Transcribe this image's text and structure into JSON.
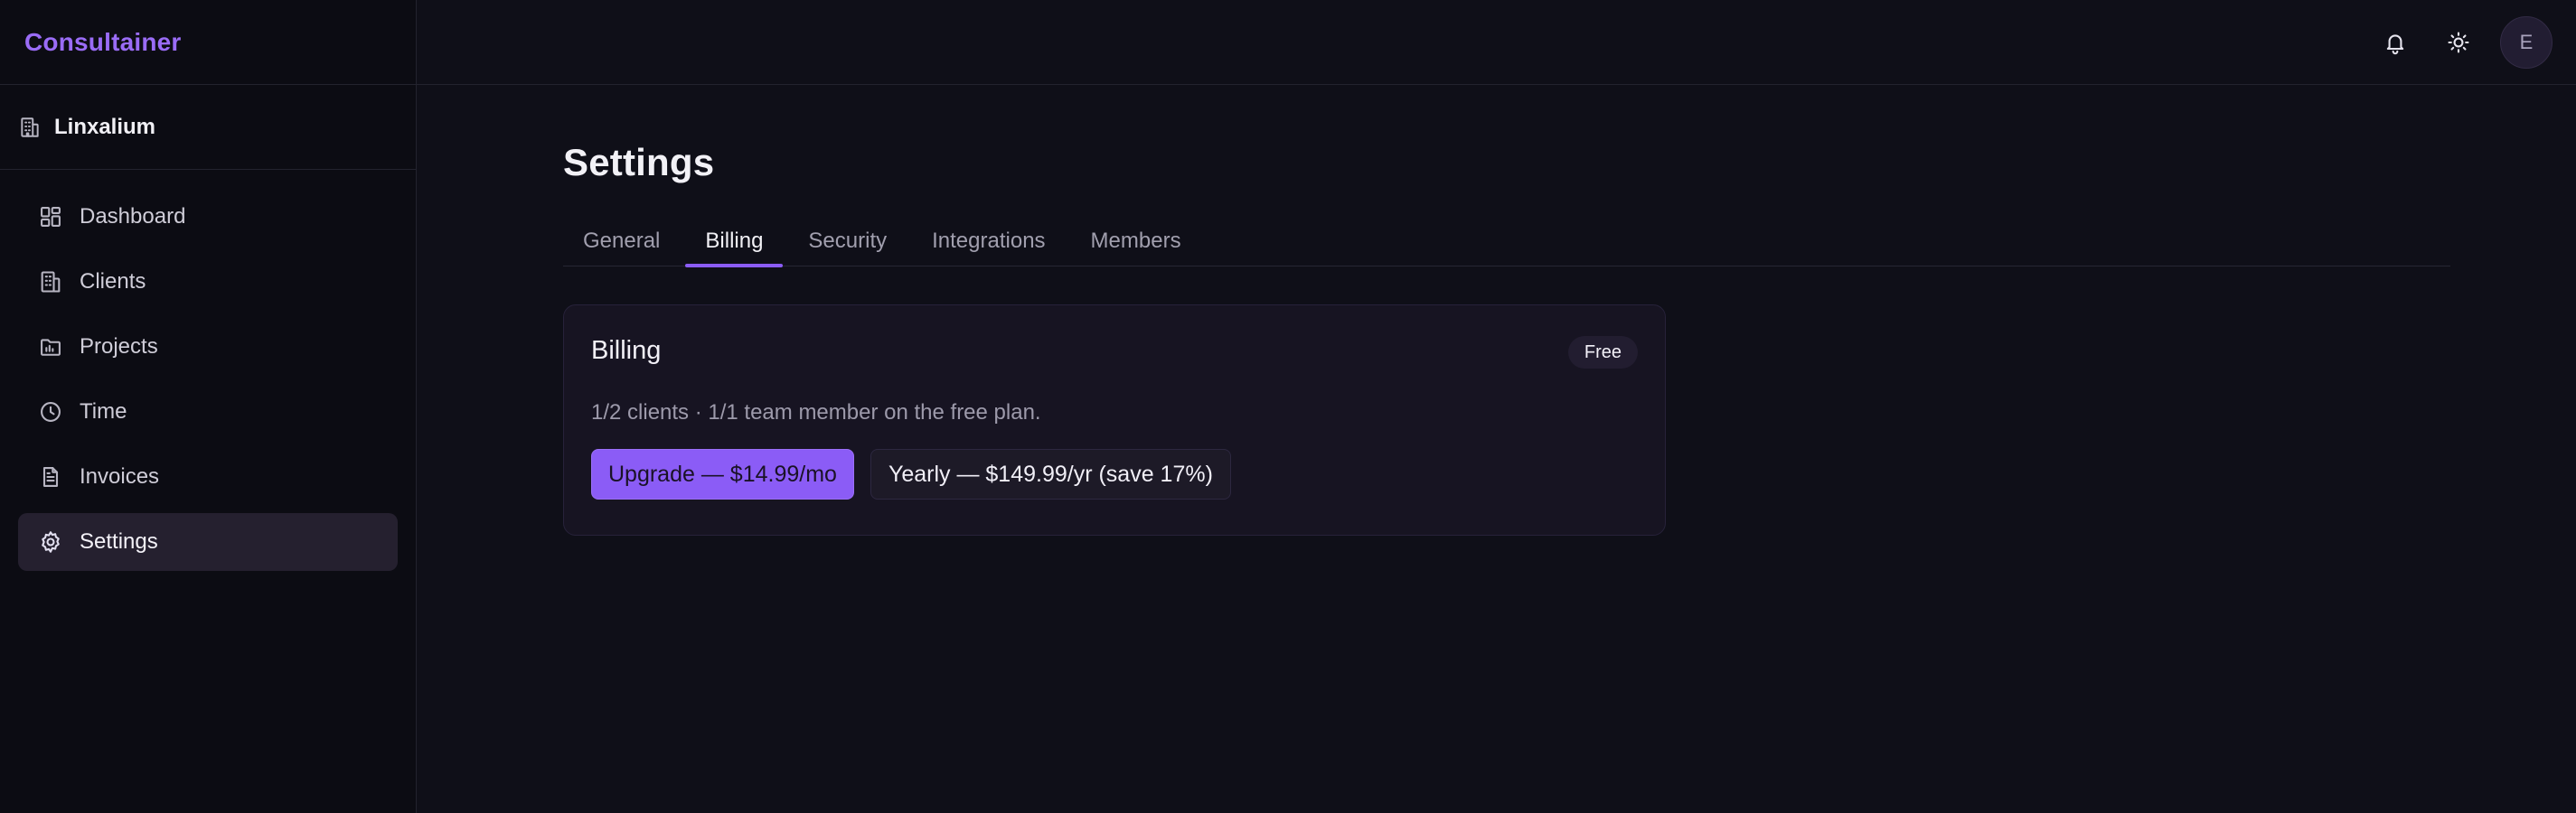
{
  "app": {
    "brand": "Consultainer"
  },
  "org": {
    "name": "Linxalium"
  },
  "sidebar": {
    "items": [
      {
        "label": "Dashboard",
        "icon": "dashboard-icon"
      },
      {
        "label": "Clients",
        "icon": "building-icon"
      },
      {
        "label": "Projects",
        "icon": "folder-icon"
      },
      {
        "label": "Time",
        "icon": "clock-icon"
      },
      {
        "label": "Invoices",
        "icon": "file-icon"
      },
      {
        "label": "Settings",
        "icon": "gear-icon",
        "active": true
      }
    ]
  },
  "topbar": {
    "avatar_initial": "E"
  },
  "page": {
    "title": "Settings"
  },
  "tabs": [
    {
      "label": "General"
    },
    {
      "label": "Billing",
      "active": true
    },
    {
      "label": "Security"
    },
    {
      "label": "Integrations"
    },
    {
      "label": "Members"
    }
  ],
  "billing": {
    "title": "Billing",
    "plan_badge": "Free",
    "usage": "1/2 clients · 1/1 team member on the free plan.",
    "upgrade_label": "Upgrade — $14.99/mo",
    "yearly_label": "Yearly — $149.99/yr (save 17%)"
  },
  "colors": {
    "accent": "#8b5cf6",
    "brand": "#9a6cf6",
    "background": "#0f0f18"
  }
}
